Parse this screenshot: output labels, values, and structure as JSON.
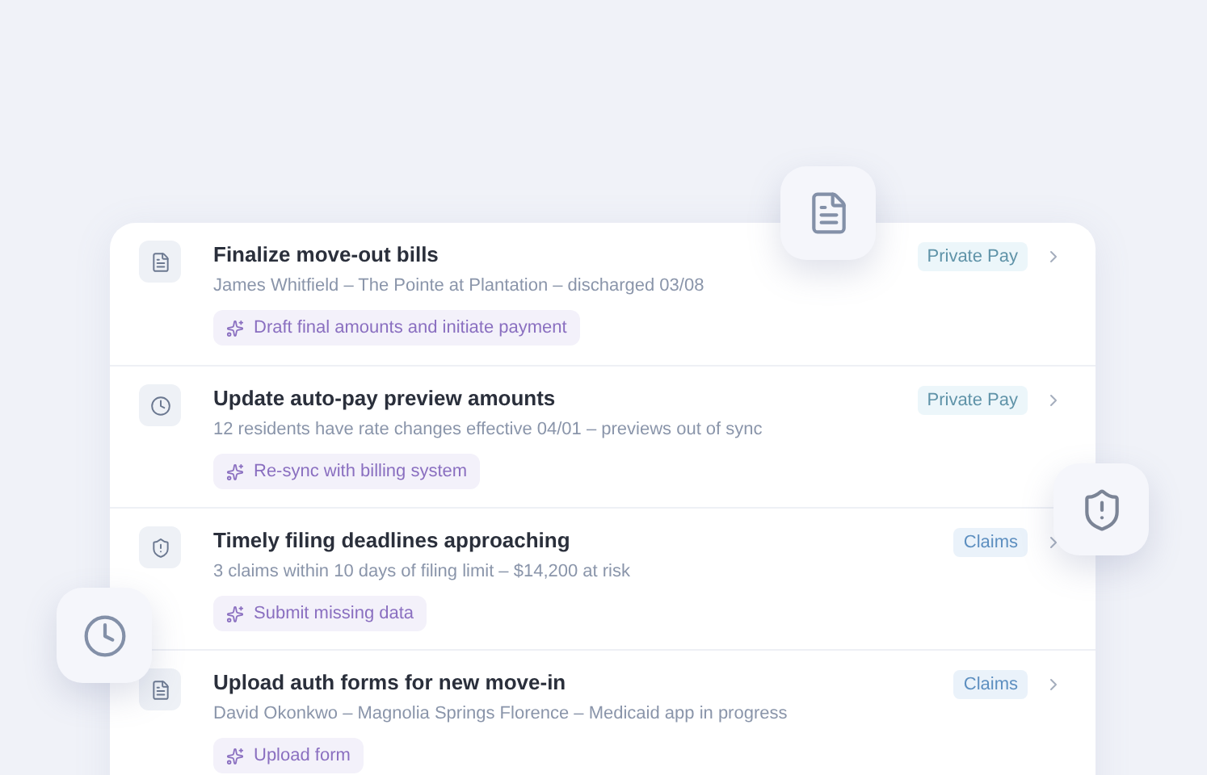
{
  "tasks": [
    {
      "kind": "document",
      "title": "Finalize move-out bills",
      "detail": "James Whitfield – The Pointe at Plantation – discharged 03/08",
      "action": "Draft final amounts and initiate payment",
      "tag": {
        "label": "Private Pay",
        "kind": "private"
      }
    },
    {
      "kind": "clock",
      "title": "Update auto-pay preview amounts",
      "detail": "12 residents have rate changes effective 04/01 – previews out of sync",
      "action": "Re-sync with billing system",
      "tag": {
        "label": "Private Pay",
        "kind": "private"
      }
    },
    {
      "kind": "shield",
      "title": "Timely filing deadlines approaching",
      "detail": "3 claims within 10 days of filing limit – $14,200 at risk",
      "action": "Submit missing data",
      "tag": {
        "label": "Claims",
        "kind": "claims"
      }
    },
    {
      "kind": "document",
      "title": "Upload auth forms for new move-in",
      "detail": "David Okonkwo – Magnolia Springs Florence – Medicaid app in progress",
      "action": "Upload form",
      "tag": {
        "label": "Claims",
        "kind": "claims"
      }
    }
  ]
}
